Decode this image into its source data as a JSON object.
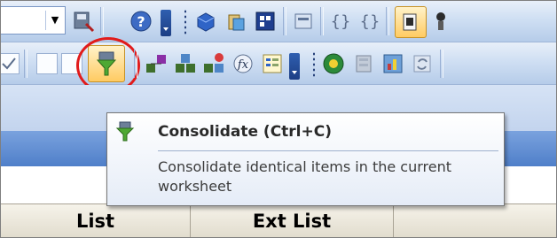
{
  "tooltip": {
    "title": "Consolidate (Ctrl+C)",
    "description": "Consolidate identical items in the current worksheet"
  },
  "column_headers": [
    "List",
    "Ext List",
    ""
  ],
  "name_box": {
    "value": ""
  },
  "icons": {
    "row1": [
      "save-network-icon",
      "help-icon",
      "box-icon",
      "clipboard-copy-icon",
      "grid-icon",
      "window-icon",
      "brace-left-icon",
      "brace-right-icon",
      "paste-special-icon",
      "extra-icon"
    ],
    "row2": [
      "checkbox-icon",
      "checkbox-icon",
      "consolidate-icon",
      "network-paste-icon",
      "network-copy-icon",
      "network-add-icon",
      "formula-icon",
      "table-list-icon",
      "globe-icon",
      "database-icon",
      "network-chart-icon",
      "refresh-icon"
    ]
  },
  "colors": {
    "tooltip_border": "#767676",
    "highlight_ring": "#e11b1b",
    "active_button": "#ffcb62"
  }
}
